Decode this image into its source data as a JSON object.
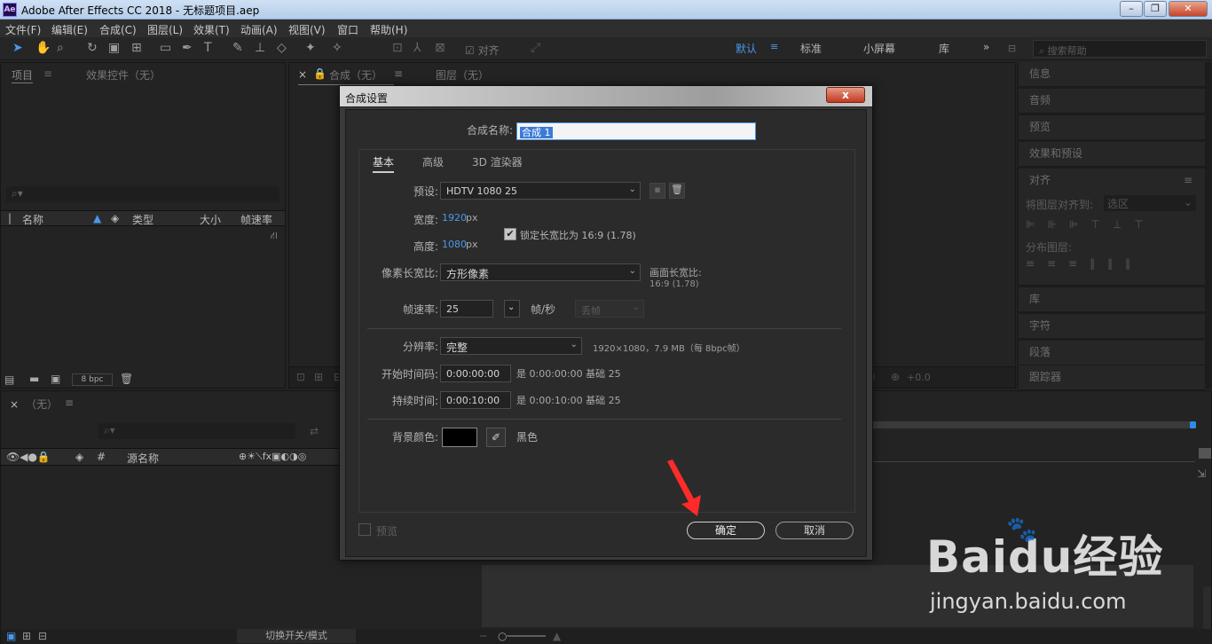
{
  "window": {
    "title": "Adobe After Effects CC 2018 - 无标题项目.aep",
    "app_icon": "Ae"
  },
  "menu": [
    "文件(F)",
    "编辑(E)",
    "合成(C)",
    "图层(L)",
    "效果(T)",
    "动画(A)",
    "视图(V)",
    "窗口",
    "帮助(H)"
  ],
  "toolbar": {
    "snap_label": "对齐",
    "workspaces": [
      "默认",
      "标准",
      "小屏幕",
      "库"
    ],
    "search_placeholder": "搜索帮助"
  },
  "project_panel": {
    "tabs": [
      "项目",
      "效果控件（无）"
    ],
    "columns": [
      "名称",
      "类型",
      "大小",
      "帧速率"
    ],
    "bpc": "8 bpc"
  },
  "comp_panel": {
    "tab": "合成（无）",
    "layer_tab": "图层（无）",
    "offset": "+0.0"
  },
  "right_panels": [
    "信息",
    "音频",
    "预览",
    "效果和预设",
    "对齐",
    "库",
    "字符",
    "段落",
    "跟踪器"
  ],
  "align": {
    "align_to_label": "将图层对齐到:",
    "align_to_value": "选区",
    "distribute_label": "分布图层:"
  },
  "timeline": {
    "tab": "（无）",
    "source_name": "源名称",
    "toggle_label": "切换开关/模式"
  },
  "dialog": {
    "title": "合成设置",
    "close": "x",
    "comp_name_label": "合成名称:",
    "comp_name": "合成 1",
    "tabs": [
      "基本",
      "高级",
      "3D 渲染器"
    ],
    "preset_label": "预设:",
    "preset": "HDTV 1080 25",
    "width_label": "宽度:",
    "width": "1920",
    "height_label": "高度:",
    "height": "1080",
    "px": "px",
    "lock_aspect": "锁定长宽比为 16:9 (1.78)",
    "pixel_aspect_label": "像素长宽比:",
    "pixel_aspect": "方形像素",
    "frame_aspect_label": "画面长宽比:",
    "frame_aspect": "16:9 (1.78)",
    "frame_rate_label": "帧速率:",
    "frame_rate": "25",
    "fps_unit": "帧/秒",
    "drop_frame": "丢帧",
    "resolution_label": "分辨率:",
    "resolution": "完整",
    "resolution_info": "1920×1080，7.9 MB（每 8bpc帧）",
    "start_tc_label": "开始时间码:",
    "start_tc": "0:00:00:00",
    "start_tc_info": "是 0:00:00:00  基础 25",
    "duration_label": "持续时间:",
    "duration": "0:00:10:00",
    "duration_info": "是 0:00:10:00  基础 25",
    "bg_label": "背景颜色:",
    "bg_color": "#000000",
    "bg_name": "黑色",
    "preview": "预览",
    "ok": "确定",
    "cancel": "取消"
  },
  "watermark": {
    "brand": "Baidu经验",
    "url": "jingyan.baidu.com"
  },
  "colors": {
    "accent": "#4a98e8",
    "dialog_bg": "#2b2b2b",
    "arrow": "#ff2a2a"
  }
}
